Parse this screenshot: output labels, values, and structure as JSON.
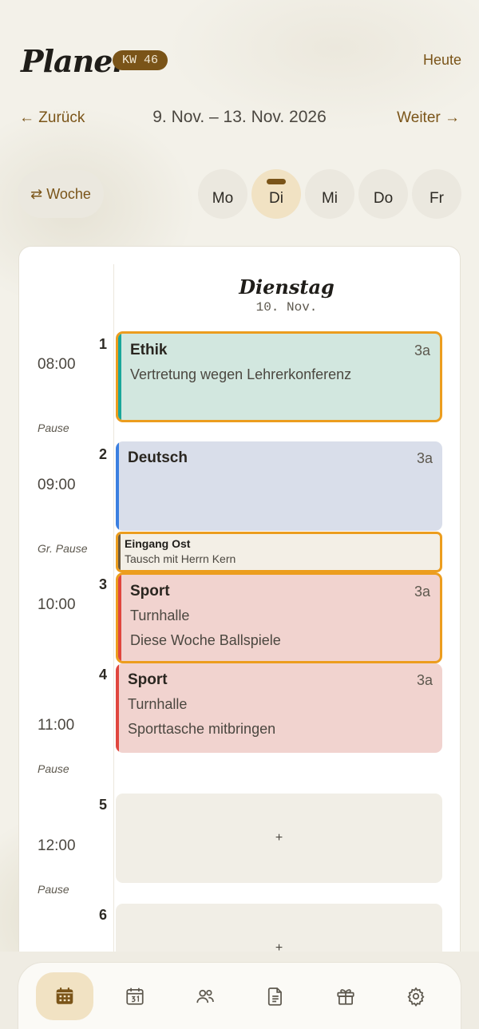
{
  "header": {
    "title": "Planer",
    "week_badge": "KW 46",
    "today_label": "Heute"
  },
  "nav": {
    "back_label": "← Zurück",
    "range_label": "9. Nov. – 13. Nov. 2026",
    "next_label": "Weiter →"
  },
  "view_toggle": {
    "label": "⇄ Woche"
  },
  "days": [
    {
      "label": "Mo",
      "active": false
    },
    {
      "label": "Di",
      "active": true
    },
    {
      "label": "Mi",
      "active": false
    },
    {
      "label": "Do",
      "active": false
    },
    {
      "label": "Fr",
      "active": false
    }
  ],
  "schedule": {
    "day_name": "Dienstag",
    "day_date": "10. Nov.",
    "times": [
      "08:00",
      "09:00",
      "10:00",
      "11:00",
      "12:00"
    ],
    "breaks": [
      "Pause",
      "Gr. Pause",
      "Pause",
      "Pause"
    ],
    "periods": [
      "1",
      "2",
      "3",
      "4",
      "5",
      "6"
    ],
    "lessons": [
      {
        "subject": "Ethik",
        "class": "3a",
        "line1": "Vertretung wegen Lehrerkonferenz",
        "line2": "",
        "color": "#d2e7df",
        "stripe": "#1aa79a",
        "highlight": true
      },
      {
        "subject": "Deutsch",
        "class": "3a",
        "line1": "",
        "line2": "",
        "color": "#d9deea",
        "stripe": "#3b7fe0",
        "highlight": false
      },
      {
        "subject": "Sport",
        "class": "3a",
        "line1": "Turnhalle",
        "line2": "Diese Woche Ballspiele",
        "color": "#f1d3cf",
        "stripe": "#e0463e",
        "highlight": true
      },
      {
        "subject": "Sport",
        "class": "3a",
        "line1": "Turnhalle",
        "line2": "Sporttasche mitbringen",
        "color": "#f1d3cf",
        "stripe": "#e0463e",
        "highlight": false
      }
    ],
    "event": {
      "title": "Eingang Ost",
      "subtitle": "Tausch mit Herrn Kern"
    },
    "empty_slot_label": "+"
  },
  "tabbar": {
    "items": [
      "calendar-week-icon",
      "calendar-day-icon",
      "people-icon",
      "document-icon",
      "gift-icon",
      "settings-icon"
    ],
    "active_index": 0
  },
  "colors": {
    "accent": "#7a5418",
    "highlight_border": "#ec9d1e",
    "active_tab_bg": "#f1e2c3"
  }
}
